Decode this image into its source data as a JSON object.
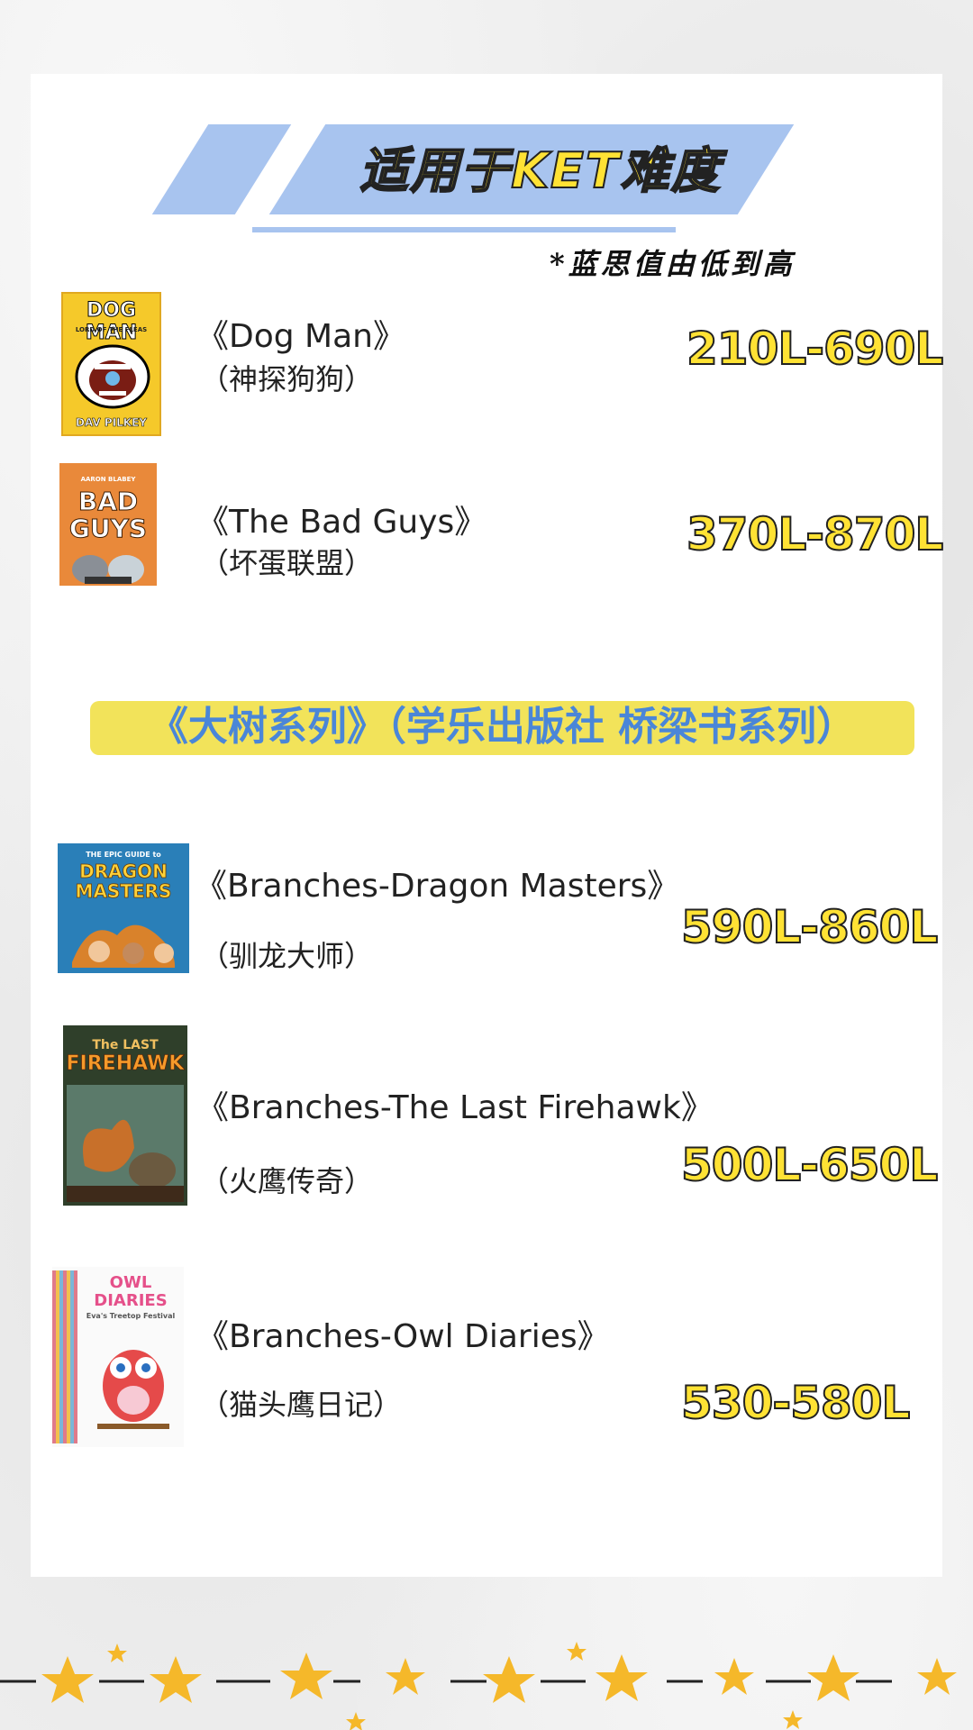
{
  "header": {
    "title": "适用于KET难度",
    "note": "*蓝思值由低到高"
  },
  "colors": {
    "banner_blue": "#a8c4ef",
    "level_yellow": "#ffe234",
    "series_highlight": "#f2e35a",
    "series_text_blue": "#4a86d8"
  },
  "books_top": [
    {
      "en_title": "《Dog Man》",
      "zh_title": "（神探狗狗）",
      "level": "210L-690L",
      "cover": {
        "title": "DOG MAN",
        "subtitle": "LORD OF THE FLEAS",
        "author": "DAV PILKEY",
        "icon": "dog-man-cover"
      }
    },
    {
      "en_title": "《The Bad Guys》",
      "zh_title": "（坏蛋联盟）",
      "level": "370L-870L",
      "cover": {
        "title": "BAD GUYS",
        "author": "AARON BLABEY",
        "icon": "bad-guys-cover"
      }
    }
  ],
  "series_heading": "《大树系列》（学乐出版社 桥梁书系列）",
  "books_series": [
    {
      "en_title": "《Branches-Dragon Masters》",
      "zh_title": "（驯龙大师）",
      "level": "590L-860L",
      "cover": {
        "title": "DRAGON MASTERS",
        "subtitle": "THE EPIC GUIDE to",
        "icon": "dragon-masters-cover"
      }
    },
    {
      "en_title": "《Branches-The Last Firehawk》",
      "zh_title": "（火鹰传奇）",
      "level": "500L-650L",
      "cover": {
        "title": "FIREHAWK",
        "subtitle": "The LAST",
        "icon": "last-firehawk-cover"
      }
    },
    {
      "en_title": "《Branches-Owl Diaries》",
      "zh_title": "（猫头鹰日记）",
      "level": "530-580L",
      "cover": {
        "title": "OWL DIARIES",
        "subtitle": "Eva's Treetop Festival",
        "icon": "owl-diaries-cover"
      }
    }
  ]
}
